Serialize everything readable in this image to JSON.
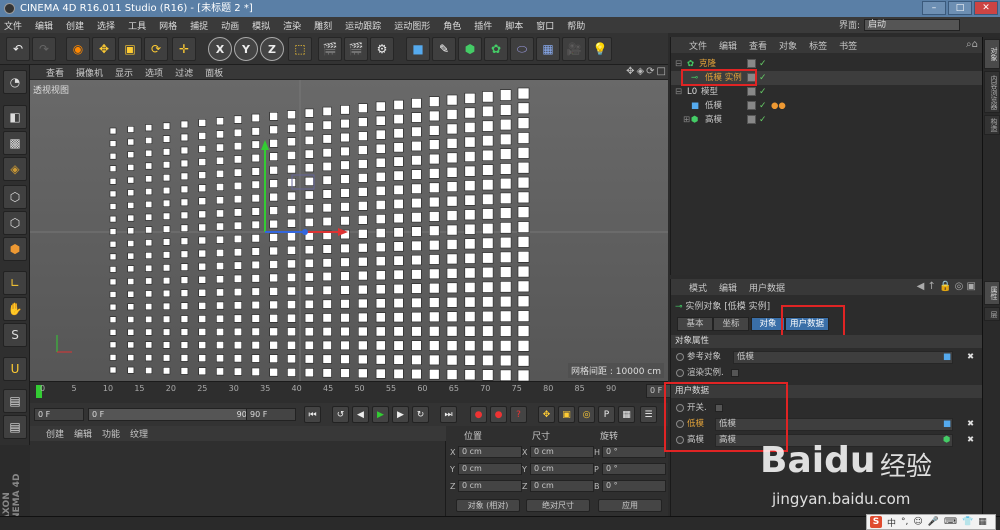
{
  "window": {
    "title": "CINEMA 4D R16.011 Studio (R16) - [未标题 2 *]"
  },
  "menubar": [
    "文件",
    "编辑",
    "创建",
    "选择",
    "工具",
    "网格",
    "捕捉",
    "动画",
    "模拟",
    "渲染",
    "雕刻",
    "运动跟踪",
    "运动图形",
    "角色",
    "插件",
    "脚本",
    "窗口",
    "帮助"
  ],
  "layout": {
    "label": "界面:",
    "value": "启动"
  },
  "toolbar": {
    "axes": [
      "X",
      "Y",
      "Z"
    ]
  },
  "viewport": {
    "menu": [
      "查看",
      "摄像机",
      "显示",
      "选项",
      "过滤",
      "面板"
    ],
    "name": "透视视图",
    "grid_spacing": "网格间距 : 10000 cm"
  },
  "timeline": {
    "ticks": [
      "0",
      "5",
      "10",
      "15",
      "20",
      "25",
      "30",
      "35",
      "40",
      "45",
      "50",
      "55",
      "60",
      "65",
      "70",
      "75",
      "80",
      "85",
      "90"
    ],
    "current_frame": "0 F"
  },
  "transport": {
    "start": "0 F",
    "range_start": "0 F",
    "range_end": "90 F",
    "end": "90 F"
  },
  "material_manager": {
    "menu": [
      "创建",
      "编辑",
      "功能",
      "纹理"
    ]
  },
  "coordinates": {
    "headers": [
      "位置",
      "尺寸",
      "旋转"
    ],
    "rows": [
      {
        "axis": "X",
        "pos": "0 cm",
        "size_axis": "X",
        "size": "0 cm",
        "rot_axis": "H",
        "rot": "0 °"
      },
      {
        "axis": "Y",
        "pos": "0 cm",
        "size_axis": "Y",
        "size": "0 cm",
        "rot_axis": "P",
        "rot": "0 °"
      },
      {
        "axis": "Z",
        "pos": "0 cm",
        "size_axis": "Z",
        "size": "0 cm",
        "rot_axis": "B",
        "rot": "0 °"
      }
    ],
    "mode": "对象 (相对)",
    "size_mode": "绝对尺寸",
    "apply": "应用"
  },
  "object_manager": {
    "menu": [
      "文件",
      "编辑",
      "查看",
      "对象",
      "标签",
      "书签"
    ],
    "objects": [
      {
        "name": "克隆",
        "level": 0
      },
      {
        "name": "低模 实例",
        "level": 1
      },
      {
        "name": "模型",
        "level": 0
      },
      {
        "name": "低模",
        "level": 1
      },
      {
        "name": "高模",
        "level": 1
      }
    ]
  },
  "attribute_manager": {
    "menu": [
      "模式",
      "编辑",
      "用户数据"
    ],
    "object_title": "实例对象 [低模 实例]",
    "tabs": [
      "基本",
      "坐标",
      "对象",
      "用户数据"
    ],
    "section_object": "对象属性",
    "ref_label": "参考对象",
    "ref_value": "低模",
    "render_instance": "渲染实例.",
    "section_user": "用户数据",
    "switch_label": "开关.",
    "user_rows": [
      {
        "label": "低模",
        "value": "低模"
      },
      {
        "label": "高模",
        "value": "高模"
      }
    ]
  },
  "right_tabs": [
    "对象",
    "内容浏览器",
    "构造",
    "属性",
    "层"
  ],
  "branding": {
    "maxon": "MAXON CINEMA 4D"
  },
  "watermark": {
    "logo": "Baidu",
    "cn": "经验",
    "url": "jingyan.baidu.com"
  },
  "ime": {
    "logo": "S",
    "lang": "中"
  },
  "colors": {
    "accent": "#5a7fa6",
    "highlight_box": "#e02424",
    "active_tab": "#3a6fa8",
    "selected_object": "#e3a33a"
  }
}
